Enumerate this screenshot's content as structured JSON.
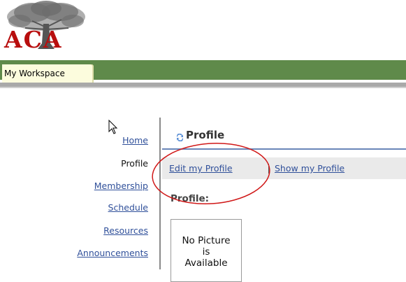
{
  "logo": {
    "text": "ACA"
  },
  "workspace_tab": {
    "label": "My Workspace"
  },
  "menu": {
    "items": [
      {
        "label": "Home",
        "link": true
      },
      {
        "label": "Profile",
        "link": false
      },
      {
        "label": "Membership",
        "link": true
      },
      {
        "label": "Schedule",
        "link": true
      },
      {
        "label": "Resources",
        "link": true
      },
      {
        "label": "Announcements",
        "link": true
      }
    ]
  },
  "main": {
    "title": "Profile",
    "toolbar": {
      "edit_label": "Edit my Profile",
      "show_label": "Show my Profile"
    },
    "section_label": "Profile:",
    "picture_placeholder": [
      "No Picture",
      "is",
      "Available"
    ]
  },
  "colors": {
    "banner": "#5f8a4a",
    "tab": "#fcfcdd",
    "link": "#30509a",
    "annotation_circle": "#d01818",
    "logo_text": "#b80e0e"
  }
}
